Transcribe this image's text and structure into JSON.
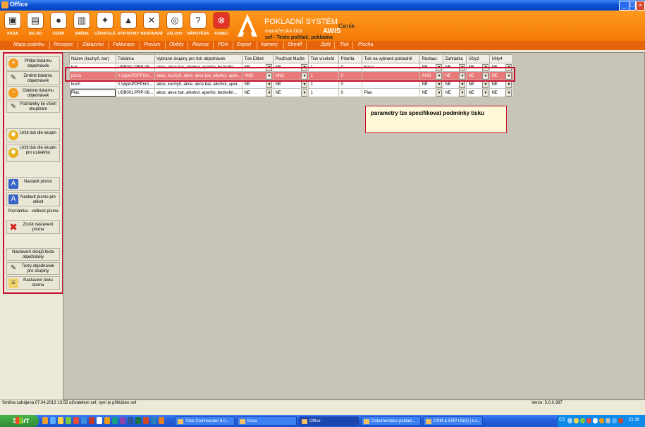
{
  "window": {
    "title": "Office"
  },
  "toolbar": {
    "buttons": [
      {
        "label": "KASA",
        "icon": "register-icon"
      },
      {
        "label": "SKLAD",
        "icon": "warehouse-icon"
      },
      {
        "label": "CENÍK",
        "icon": "pricelist-icon"
      },
      {
        "label": "SMĚNA",
        "icon": "shift-icon"
      },
      {
        "label": "UŽIVATELÉ",
        "icon": "users-icon"
      },
      {
        "label": "STATISTIKY",
        "icon": "statistics-icon"
      },
      {
        "label": "NASTAVENÍ",
        "icon": "settings-icon"
      },
      {
        "label": "ZÁLOHY",
        "icon": "backup-icon"
      },
      {
        "label": "NÁPOVĚDA",
        "icon": "help-icon"
      },
      {
        "label": "KONEC",
        "icon": "exit-icon"
      }
    ]
  },
  "brand": {
    "name": "POKLADNÍ SYSTÉM",
    "sub": "manažerská část",
    "awis": "AWIS",
    "user_line": "sef  -  Tento počítač, pokladna",
    "module": "Ceník"
  },
  "menu": [
    "Mapa podniku",
    "Recepce",
    "Zákazníci",
    "Fakturace",
    "Provize",
    "Obědy",
    "Rozvoz",
    "PDA",
    "Export",
    "Kamery",
    "Sheriff",
    "Zpět",
    "Tisk",
    "Plocha"
  ],
  "sidebar": {
    "buttons": [
      {
        "label": "Přidat tiskárnu objednávek",
        "icon": "add-icon"
      },
      {
        "label": "Změnit tiskárnu objednávek",
        "icon": "pencil-icon"
      },
      {
        "label": "Odebrat tiskárnu objednávek",
        "icon": "remove-icon"
      },
      {
        "label": "Poznámky ke všem skupinám",
        "icon": "pencil-icon"
      },
      {
        "label": "Určit tisk dle skupin",
        "icon": "gear-icon"
      },
      {
        "label": "Určit tisk dle skupin pro uzávěrku",
        "icon": "gear-icon"
      },
      {
        "label": "Nastavit písmo",
        "icon": "font-icon"
      },
      {
        "label": "Nastavit písmo pro etiket",
        "icon": "font-icon"
      },
      {
        "label": "Zrušit nastavení písma",
        "icon": "delete-icon"
      },
      {
        "label": "Nastavení okrajů textu objednávky",
        "icon": ""
      },
      {
        "label": "Texty objednávek pro skupiny",
        "icon": "pencil-icon"
      },
      {
        "label": "Nastavení textu storna",
        "icon": "note-icon"
      }
    ],
    "note": "Poznámka - velikost písma"
  },
  "grid": {
    "columns": [
      "Název (kuchyň, bar)",
      "Tiskárna",
      "Vybrané skupiny pro tisk objednávek",
      "Tisk Etiket",
      "Používat Marže",
      "Tisk vícekrát",
      "Priorita",
      "Tisk na vybrané pokladně",
      "Restaur.",
      "Zahrádka",
      "Účty3",
      "Účty4"
    ],
    "rows": [
      {
        "cells": [
          "bar",
          "USB001:PRP-08...",
          "akce, akce bar, alkohol, aperitiv, bezkofei...",
          "NE",
          "NE",
          "1",
          "0",
          "Kasa",
          "NE",
          "NE",
          "NE",
          "NE"
        ],
        "selected": false
      },
      {
        "cells": [
          "pizza",
          "\\\\.\\pipe\\PDFPrint...",
          "akce, kuchyň, akce, akce bar, alkohol, aper...",
          "ANO",
          "ANO",
          "1",
          "0",
          "",
          "ANO",
          "NE",
          "NE",
          "NE"
        ],
        "selected": true
      },
      {
        "cells": [
          "kuch",
          "\\\\.\\pipe\\PDFPrint...",
          "akce, kuchyň, akce, akce bar, alkohol, aper...",
          "NE",
          "NE",
          "1",
          "0",
          "",
          "NE",
          "NE",
          "NE",
          "NE"
        ],
        "selected": false
      },
      {
        "cells": [
          "Plac",
          "USB001:PRP-08...",
          "akce, akce bar, alkohol, aperitiv, bezkofei...",
          "NE",
          "NE",
          "1",
          "0",
          "Plac",
          "NE",
          "NE",
          "NE",
          "NE"
        ],
        "selected": false
      }
    ]
  },
  "callout": "parametry lze specifikovat podmínky tisku",
  "status": {
    "left": "Směna zahájena 07.04.2013 13:55 uživatelem sef, nyní je přihlášen sef",
    "right": "Verze: 5.0.0.387"
  },
  "taskbar": {
    "start": "Start",
    "tasks": [
      "Total Commander 8.0...",
      "Kasa",
      "Office",
      "Dokumentace-poklad...",
      "CRM & ERP UNIQ | Lo..."
    ],
    "lang": "CS",
    "clock": "21:36"
  },
  "colors": {
    "accent": "#f47a08",
    "highlight": "#c8102e",
    "selected_row": "#e97878"
  }
}
